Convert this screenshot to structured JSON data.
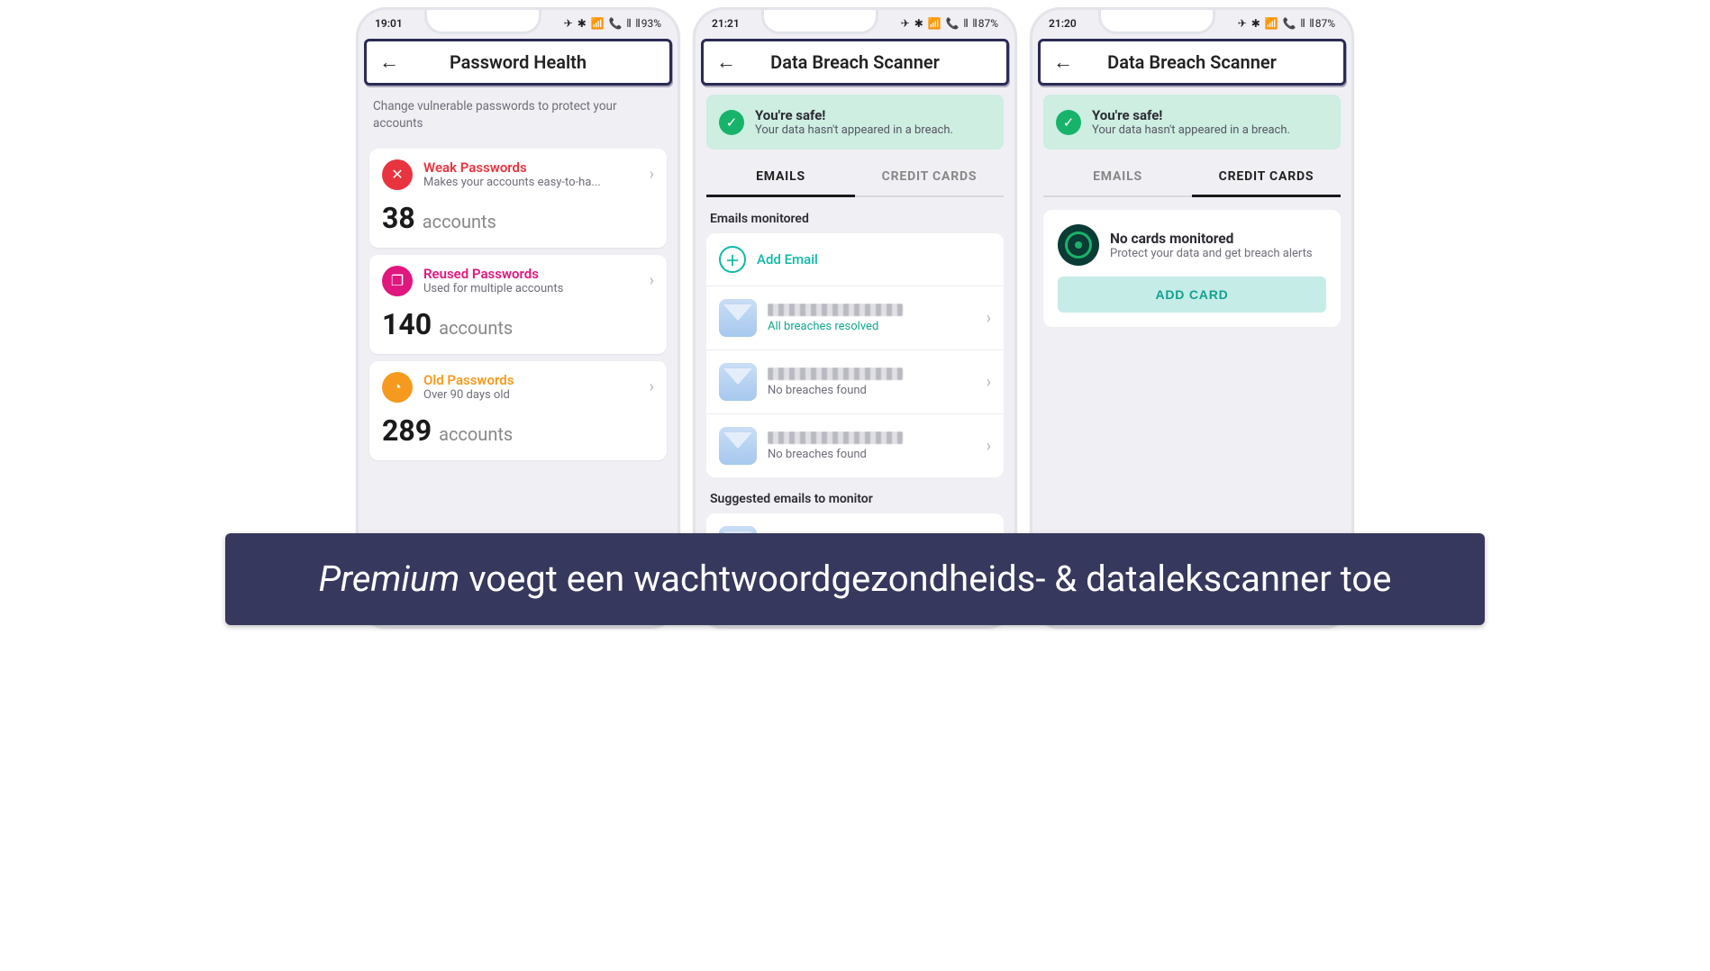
{
  "phone1": {
    "time": "19:01",
    "battery": "93%",
    "status_icons": "✈ ✱ 📶 📞 ⫴ ⫴ ",
    "title": "Password Health",
    "desc": "Change vulnerable passwords to protect your accounts",
    "weak": {
      "title": "Weak Passwords",
      "sub": "Makes your accounts easy-to-ha...",
      "count": "38",
      "label": "accounts"
    },
    "reused": {
      "title": "Reused Passwords",
      "sub": "Used for multiple accounts",
      "count": "140",
      "label": "accounts"
    },
    "old": {
      "title": "Old Passwords",
      "sub": "Over 90 days old",
      "count": "289",
      "label": "accounts"
    }
  },
  "phone2": {
    "time": "21:21",
    "battery": "87%",
    "status_icons": "✈ ✱ 📶 📞 ⫴ ⫴ ",
    "title": "Data Breach Scanner",
    "safe_title": "You're safe!",
    "safe_sub": "Your data hasn't appeared in a breach.",
    "tab_emails": "EMAILS",
    "tab_cards": "CREDIT CARDS",
    "active_tab": "emails",
    "emails_monitored_label": "Emails monitored",
    "add_email": "Add Email",
    "email1_status": "All breaches resolved",
    "email2_status": "No breaches found",
    "email3_status": "No breaches found",
    "suggested_label": "Suggested emails to monitor"
  },
  "phone3": {
    "time": "21:20",
    "battery": "87%",
    "status_icons": "✈ ✱ 📶 📞 ⫴ ⫴ ",
    "title": "Data Breach Scanner",
    "safe_title": "You're safe!",
    "safe_sub": "Your data hasn't appeared in a breach.",
    "tab_emails": "EMAILS",
    "tab_cards": "CREDIT CARDS",
    "active_tab": "cards",
    "no_cards_title": "No cards monitored",
    "no_cards_sub": "Protect your data and get breach alerts",
    "add_card": "ADD CARD"
  },
  "footer_premium": "Premium",
  "footer_rest": " voegt een wachtwoordgezondheids- & datalekscanner toe"
}
